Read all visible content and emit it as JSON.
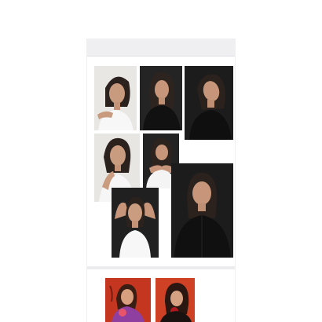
{
  "feed": {
    "post_1": {
      "photos": [
        {
          "icon": "portrait-photo",
          "tone": "light"
        },
        {
          "icon": "portrait-photo",
          "tone": "dark"
        },
        {
          "icon": "portrait-photo",
          "tone": "dark"
        },
        {
          "icon": "portrait-photo",
          "tone": "light"
        },
        {
          "icon": "portrait-photo",
          "tone": "dark"
        },
        {
          "icon": "portrait-photo",
          "tone": "dark"
        },
        {
          "icon": "portrait-photo",
          "tone": "dark"
        }
      ]
    },
    "post_2": {
      "photos": [
        {
          "icon": "portrait-photo",
          "tone": "red"
        },
        {
          "icon": "portrait-photo",
          "tone": "red"
        }
      ]
    }
  },
  "colors": {
    "header_bar": "#efeff1",
    "light_backdrop": "#e7e5e2",
    "dark_backdrop": "#1e1e1f",
    "red_backdrop": "#c8361f"
  }
}
